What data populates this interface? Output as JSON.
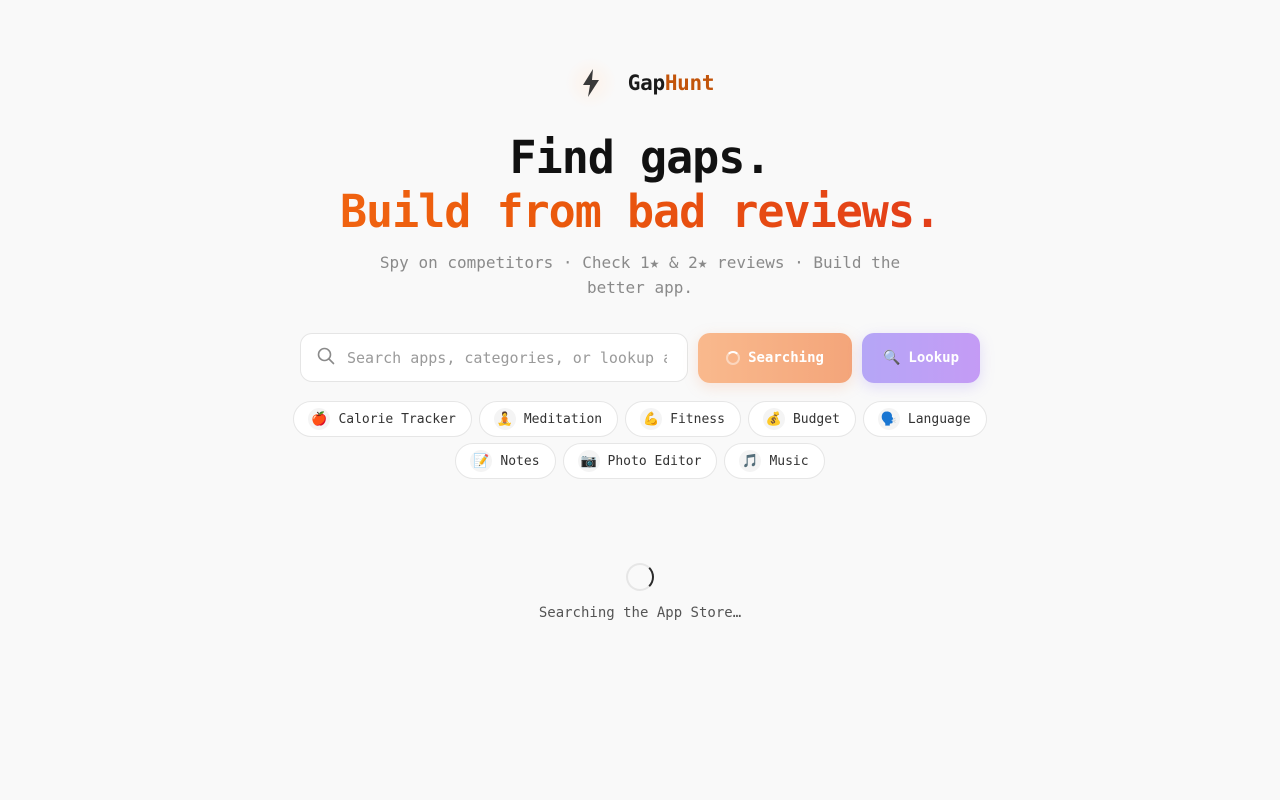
{
  "brand": {
    "name_part1": "Gap",
    "name_part2": "Hunt",
    "logo_icon": "lightning-bolt-icon"
  },
  "hero": {
    "line1": "Find gaps.",
    "line2": "Build from bad reviews.",
    "subtitle": "Spy on competitors · Check 1★ & 2★ reviews · Build the better app."
  },
  "search": {
    "placeholder": "Search apps, categories, or lookup a",
    "value": ""
  },
  "buttons": {
    "search_label": "Searching",
    "lookup_label": "Lookup",
    "lookup_emoji": "🔍"
  },
  "chips_row1": [
    {
      "emoji": "🍎",
      "label": "Calorie Tracker"
    },
    {
      "emoji": "🧘",
      "label": "Meditation"
    },
    {
      "emoji": "💪",
      "label": "Fitness"
    },
    {
      "emoji": "💰",
      "label": "Budget"
    },
    {
      "emoji": "🗣️",
      "label": "Language"
    }
  ],
  "chips_row2": [
    {
      "emoji": "📝",
      "label": "Notes"
    },
    {
      "emoji": "📷",
      "label": "Photo Editor"
    },
    {
      "emoji": "🎵",
      "label": "Music"
    }
  ],
  "status": {
    "text": "Searching the App Store…"
  },
  "colors": {
    "accent_orange": "#f97316",
    "accent_red": "#dc2626",
    "lookup_purple": "#b5a6f6"
  }
}
